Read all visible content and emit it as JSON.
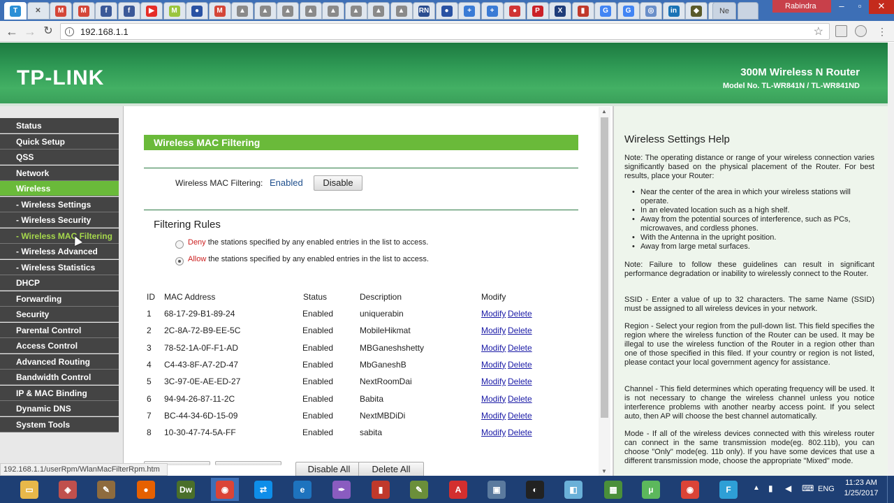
{
  "browser": {
    "profile_name": "Rabindra",
    "new_tab_label": "Ne",
    "url": "192.168.1.1",
    "status_url": "192.168.1.1/userRpm/WlanMacFilterRpm.htm",
    "tabs": [
      {
        "icon": "tplink-icon",
        "glyph": "T",
        "color": "#2a8fd6"
      },
      {
        "icon": "close-icon",
        "glyph": "✕",
        "color": "#666"
      },
      {
        "icon": "gmail-icon",
        "glyph": "M",
        "color": "#d44638"
      },
      {
        "icon": "gmail-icon",
        "glyph": "M",
        "color": "#d44638"
      },
      {
        "icon": "facebook-icon",
        "glyph": "f",
        "color": "#3b5998"
      },
      {
        "icon": "facebook-icon",
        "glyph": "f",
        "color": "#3b5998"
      },
      {
        "icon": "youtube-icon",
        "glyph": "▶",
        "color": "#e52d27"
      },
      {
        "icon": "m-icon",
        "glyph": "M",
        "color": "#9bc53d"
      },
      {
        "icon": "shield-icon",
        "glyph": "●",
        "color": "#2952a3"
      },
      {
        "icon": "gmail-icon",
        "glyph": "M",
        "color": "#d44638"
      },
      {
        "icon": "generic-page-icon",
        "glyph": "▲",
        "color": "#8a8a8a"
      },
      {
        "icon": "generic-page-icon",
        "glyph": "▲",
        "color": "#8a8a8a"
      },
      {
        "icon": "generic-page-icon",
        "glyph": "▲",
        "color": "#8a8a8a"
      },
      {
        "icon": "generic-page-icon",
        "glyph": "▲",
        "color": "#8a8a8a"
      },
      {
        "icon": "generic-page-icon",
        "glyph": "▲",
        "color": "#8a8a8a"
      },
      {
        "icon": "generic-page-icon",
        "glyph": "▲",
        "color": "#8a8a8a"
      },
      {
        "icon": "generic-page-icon",
        "glyph": "▲",
        "color": "#8a8a8a"
      },
      {
        "icon": "generic-page-icon",
        "glyph": "▲",
        "color": "#8a8a8a"
      },
      {
        "icon": "rn-icon",
        "glyph": "RN",
        "color": "#2a4d8f"
      },
      {
        "icon": "shield-icon",
        "glyph": "●",
        "color": "#2952a3"
      },
      {
        "icon": "flag-icon",
        "glyph": "+",
        "color": "#3a7bd5"
      },
      {
        "icon": "flag-icon",
        "glyph": "+",
        "color": "#3a7bd5"
      },
      {
        "icon": "red-circle-icon",
        "glyph": "●",
        "color": "#d03434"
      },
      {
        "icon": "pinterest-icon",
        "glyph": "P",
        "color": "#cb2027"
      },
      {
        "icon": "x-icon",
        "glyph": "X",
        "color": "#1f3d7a"
      },
      {
        "icon": "chart-icon",
        "glyph": "▮",
        "color": "#c0392b"
      },
      {
        "icon": "google-icon",
        "glyph": "G",
        "color": "#4285f4"
      },
      {
        "icon": "google-icon",
        "glyph": "G",
        "color": "#4285f4"
      },
      {
        "icon": "globe-icon",
        "glyph": "◎",
        "color": "#6a8fc9"
      },
      {
        "icon": "in-icon",
        "glyph": "in",
        "color": "#1a73b5"
      },
      {
        "icon": "tool-icon",
        "glyph": "◆",
        "color": "#5a5a2a"
      },
      {
        "icon": "tool-icon",
        "glyph": "◆",
        "color": "#5a5a2a"
      }
    ]
  },
  "router": {
    "brand": "TP-LINK",
    "model": "300M Wireless N Router",
    "model_no": "Model No. TL-WR841N / TL-WR841ND"
  },
  "menu": [
    {
      "label": "Status",
      "type": "main",
      "state": ""
    },
    {
      "label": "Quick Setup",
      "type": "main",
      "state": ""
    },
    {
      "label": "QSS",
      "type": "main",
      "state": ""
    },
    {
      "label": "Network",
      "type": "main",
      "state": ""
    },
    {
      "label": "Wireless",
      "type": "main",
      "state": "sel"
    },
    {
      "label": "- Wireless Settings",
      "type": "sub",
      "state": ""
    },
    {
      "label": "- Wireless Security",
      "type": "sub",
      "state": ""
    },
    {
      "label": "- Wireless MAC Filtering",
      "type": "sub",
      "state": "subsel"
    },
    {
      "label": "- Wireless Advanced",
      "type": "sub",
      "state": ""
    },
    {
      "label": "- Wireless Statistics",
      "type": "sub",
      "state": ""
    },
    {
      "label": "DHCP",
      "type": "main",
      "state": ""
    },
    {
      "label": "Forwarding",
      "type": "main",
      "state": ""
    },
    {
      "label": "Security",
      "type": "main",
      "state": ""
    },
    {
      "label": "Parental Control",
      "type": "main",
      "state": ""
    },
    {
      "label": "Access Control",
      "type": "main",
      "state": ""
    },
    {
      "label": "Advanced Routing",
      "type": "main",
      "state": ""
    },
    {
      "label": "Bandwidth Control",
      "type": "main",
      "state": ""
    },
    {
      "label": "IP & MAC Binding",
      "type": "main",
      "state": ""
    },
    {
      "label": "Dynamic DNS",
      "type": "main",
      "state": ""
    },
    {
      "label": "System Tools",
      "type": "main",
      "state": ""
    }
  ],
  "main": {
    "section_title": "Wireless MAC Filtering",
    "filter_label": "Wireless MAC Filtering:",
    "filter_status": "Enabled",
    "disable_button": "Disable",
    "rules_title": "Filtering Rules",
    "deny_word": "Deny",
    "deny_text": "the stations specified by any enabled entries in the list to access.",
    "allow_word": "Allow",
    "allow_text": "the stations specified by any enabled entries in the list to access.",
    "selected_rule": "allow",
    "columns": [
      "ID",
      "MAC Address",
      "Status",
      "Description",
      "Modify"
    ],
    "rows": [
      {
        "id": "1",
        "mac": "68-17-29-B1-89-24",
        "status": "Enabled",
        "desc": "uniquerabin"
      },
      {
        "id": "2",
        "mac": "2C-8A-72-B9-EE-5C",
        "status": "Enabled",
        "desc": "MobileHikmat"
      },
      {
        "id": "3",
        "mac": "78-52-1A-0F-F1-AD",
        "status": "Enabled",
        "desc": "MBGaneshshetty"
      },
      {
        "id": "4",
        "mac": "C4-43-8F-A7-2D-47",
        "status": "Enabled",
        "desc": "MbGaneshB"
      },
      {
        "id": "5",
        "mac": "3C-97-0E-AE-ED-27",
        "status": "Enabled",
        "desc": "NextRoomDai"
      },
      {
        "id": "6",
        "mac": "94-94-26-87-11-2C",
        "status": "Enabled",
        "desc": "Babita"
      },
      {
        "id": "7",
        "mac": "BC-44-34-6D-15-09",
        "status": "Enabled",
        "desc": "NextMBDiDi"
      },
      {
        "id": "8",
        "mac": "10-30-47-74-5A-FF",
        "status": "Enabled",
        "desc": "sabita"
      }
    ],
    "modify_label": "Modify",
    "delete_label": "Delete",
    "disable_all_button": "Disable All",
    "delete_all_button": "Delete All"
  },
  "help": {
    "title": "Wireless Settings Help",
    "note1_key": "Note",
    "note1": ": The operating distance or range of your wireless connection varies significantly based on the physical placement of the Router. For best results, place your Router:",
    "bullets": [
      "Near the center of the area in which your wireless stations will operate.",
      "In an elevated location such as a high shelf.",
      "Away from the potential sources of interference, such as PCs, microwaves, and cordless phones.",
      "With the Antenna in the upright position.",
      "Away from large metal surfaces."
    ],
    "note2_key": "Note",
    "note2": ": Failure to follow these guidelines can result in significant performance degradation or inability to wirelessly connect to the Router.",
    "ssid_key": "SSID",
    "ssid": " - Enter a value of up to 32 characters. The same Name (SSID) must be assigned to all wireless devices in your network.",
    "region_key": "Region",
    "region": " - Select your region from the pull-down list. This field specifies the region where the wireless function of the Router can be used. It may be illegal to use the wireless function of the Router in a region other than one of those specified in this filed. If your country or region is not listed, please contact your local government agency for assistance.",
    "channel_key": "Channel",
    "channel": " - This field determines which operating frequency will be used. It is not necessary to change the wireless channel unless you notice interference problems with another nearby access point. If you select auto, then AP will choose the best channel automatically.",
    "mode_key": "Mode",
    "mode": " - If all of the wireless devices connected with this wireless router can connect in the same transmission mode(eg. 802.11b), you can choose \"Only\" mode(eg. 11b only). If you have some devices that use a different transmission mode, choose the appropriate \"Mixed\" mode."
  },
  "taskbar": {
    "apps": [
      {
        "icon": "file-explorer-icon",
        "glyph": "▭",
        "color": "#e8b84a"
      },
      {
        "icon": "installer-icon",
        "glyph": "◈",
        "color": "#c0504d"
      },
      {
        "icon": "tools-icon",
        "glyph": "✎",
        "color": "#8e6b3e"
      },
      {
        "icon": "firefox-icon",
        "glyph": "●",
        "color": "#e66000"
      },
      {
        "icon": "dreamweaver-icon",
        "glyph": "Dw",
        "color": "#4a6f2a"
      },
      {
        "icon": "chrome-icon",
        "glyph": "◉",
        "color": "#db4437"
      },
      {
        "icon": "teamviewer-icon",
        "glyph": "⇄",
        "color": "#0e8ee9"
      },
      {
        "icon": "edge-icon",
        "glyph": "e",
        "color": "#1e73be"
      },
      {
        "icon": "feather-icon",
        "glyph": "✒",
        "color": "#8a5cc0"
      },
      {
        "icon": "book-icon",
        "glyph": "▮",
        "color": "#c0392b"
      },
      {
        "icon": "notepad-icon",
        "glyph": "✎",
        "color": "#6b8f3a"
      },
      {
        "icon": "acrobat-icon",
        "glyph": "A",
        "color": "#d32f2f"
      },
      {
        "icon": "window-icon",
        "glyph": "▣",
        "color": "#5b7a9e"
      },
      {
        "icon": "chat-icon",
        "glyph": "◐",
        "color": "#222222"
      },
      {
        "icon": "glass-icon",
        "glyph": "◧",
        "color": "#6ab0d8"
      },
      {
        "icon": "calculator-icon",
        "glyph": "▦",
        "color": "#4a8f3a"
      },
      {
        "icon": "utorrent-icon",
        "glyph": "µ",
        "color": "#5cb85c"
      },
      {
        "icon": "chrome-icon",
        "glyph": "◉",
        "color": "#db4437"
      },
      {
        "icon": "f-icon",
        "glyph": "F",
        "color": "#2e9fd6"
      }
    ],
    "lang": "ENG",
    "time": "11:23 AM",
    "date": "1/25/2017"
  }
}
